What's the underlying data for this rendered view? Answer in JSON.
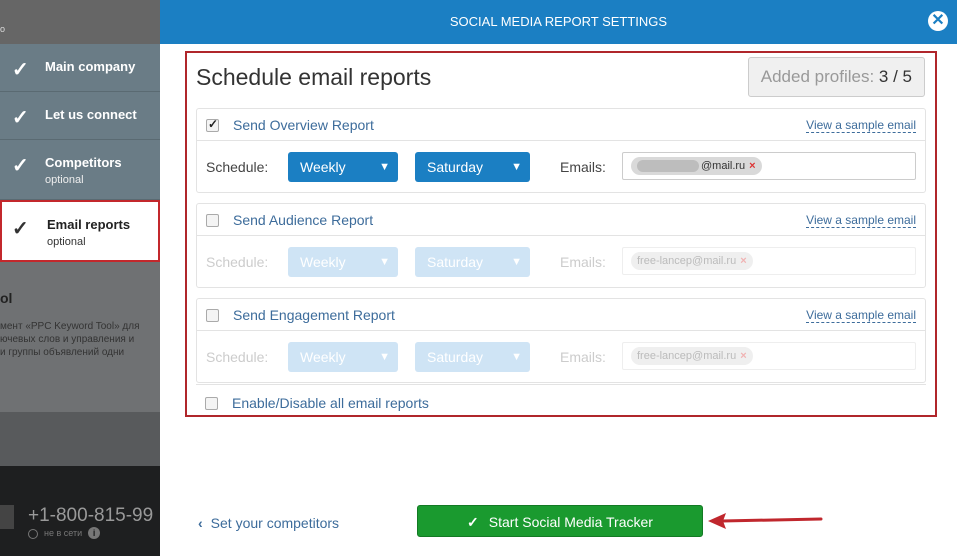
{
  "background": {
    "top_fragment": "о",
    "section_title": "ol",
    "section_text": "мент «PPC Keyword Tool» для\nючевых слов и управления и\nи группы объявлений одни",
    "phone": "+1-800-815-99",
    "online_status": "не в сети",
    "info_icon": "i"
  },
  "steps": [
    {
      "label": "Main company",
      "sub": "",
      "done": true
    },
    {
      "label": "Let us connect",
      "sub": "",
      "done": true
    },
    {
      "label": "Competitors",
      "sub": "optional",
      "done": true
    },
    {
      "label": "Email reports",
      "sub": "optional",
      "done": true,
      "active": true
    }
  ],
  "modal": {
    "title": "SOCIAL MEDIA REPORT SETTINGS",
    "close_icon": "close-icon",
    "heading": "Schedule email reports",
    "profiles_label": "Added profiles:",
    "profiles_count": "3 / 5"
  },
  "reports": [
    {
      "name": "Send Overview Report",
      "checked": true,
      "sample_link": "View a sample email",
      "schedule_label": "Schedule:",
      "frequency": "Weekly",
      "day": "Saturday",
      "emails_label": "Emails:",
      "email": "@mail.ru"
    },
    {
      "name": "Send Audience Report",
      "checked": false,
      "sample_link": "View a sample email",
      "schedule_label": "Schedule:",
      "frequency": "Weekly",
      "day": "Saturday",
      "emails_label": "Emails:",
      "email": "free-lancep@mail.ru"
    },
    {
      "name": "Send Engagement Report",
      "checked": false,
      "sample_link": "View a sample email",
      "schedule_label": "Schedule:",
      "frequency": "Weekly",
      "day": "Saturday",
      "emails_label": "Emails:",
      "email": "free-lancep@mail.ru"
    }
  ],
  "toggle_all_label": "Enable/Disable all email reports",
  "footer": {
    "back_label": "Set your competitors",
    "start_label": "Start Social Media Tracker"
  },
  "colors": {
    "header_blue": "#1b7fc3",
    "highlight_red": "#b0262b",
    "start_green": "#1a9a2f"
  }
}
